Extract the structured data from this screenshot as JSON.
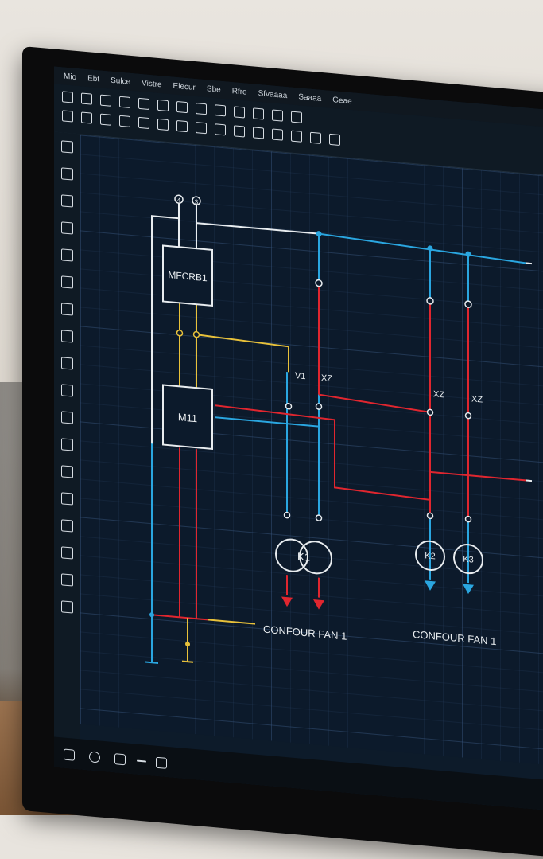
{
  "menu": [
    "Mio",
    "Ebt",
    "Sulce",
    "Vistre",
    "Eiecur",
    "Sbe",
    "Rfre",
    "Sfvaaaa",
    "Saaaa",
    "Geae"
  ],
  "diagram": {
    "terminals": [
      "4",
      "3"
    ],
    "block_top": "MFCRB1",
    "block_mid": "M11",
    "contact_1": "V1",
    "contact_2": "XZ",
    "contact_3": "XZ",
    "contact_4": "XZ",
    "motor_left": "K1",
    "motor_r1": "K2",
    "motor_r2": "K3",
    "caption_left": "CONFOUR FAN 1",
    "caption_right": "CONFOUR FAN 1"
  },
  "colors": {
    "wire_white": "#e8ecef",
    "wire_blue": "#2aa6e0",
    "wire_red": "#e0262f",
    "wire_yellow": "#e8c13a",
    "canvas_bg": "#0c1a2b"
  }
}
